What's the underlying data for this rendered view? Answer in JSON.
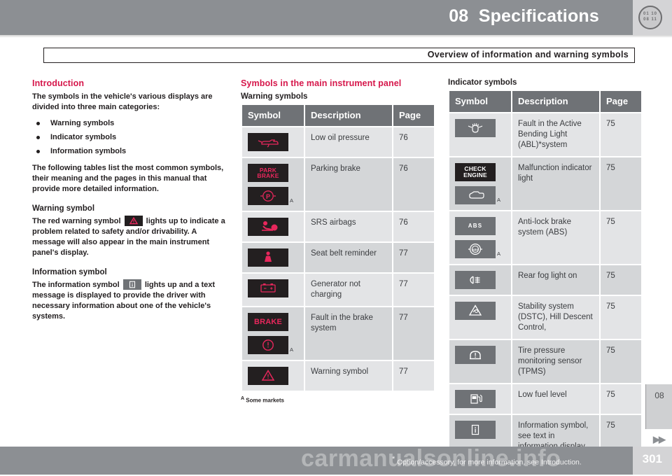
{
  "header": {
    "chapter_number": "08",
    "chapter_title": "Specifications",
    "badge_line1": "01 10",
    "badge_line2": "08 11"
  },
  "section_title": "Overview of information and warning symbols",
  "left_column": {
    "heading": "Introduction",
    "intro_paragraph": "The symbols in the vehicle's various displays are divided into three main categories:",
    "bullets": [
      "Warning symbols",
      "Indicator symbols",
      "Information symbols"
    ],
    "tables_paragraph": "The following tables list the most common symbols, their meaning and the pages in this manual that provide more detailed information.",
    "warning_heading": "Warning symbol",
    "warning_text_before": "The red warning symbol",
    "warning_text_after": "lights up to indicate a problem related to safety and/or drivability. A message will also appear in the main instrument panel's display.",
    "info_heading": "Information symbol",
    "info_text_before": "The information symbol",
    "info_text_after": "lights up and a text message is displayed to provide the driver with necessary information about one of the vehicle's systems."
  },
  "middle_column": {
    "heading": "Symbols in the main instrument panel",
    "subheading": "Warning symbols",
    "columns": [
      "Symbol",
      "Description",
      "Page"
    ],
    "rows": [
      {
        "icons": [
          {
            "kind": "oil-can",
            "style": "dark"
          }
        ],
        "description": "Low oil pressure",
        "page": "76"
      },
      {
        "icons": [
          {
            "kind": "park-brake-text",
            "style": "dark",
            "text1": "PARK",
            "text2": "BRAKE"
          },
          {
            "kind": "p-circle",
            "style": "dark",
            "note": "A"
          }
        ],
        "description": "Parking brake",
        "page": "76"
      },
      {
        "icons": [
          {
            "kind": "srs-airbag",
            "style": "dark"
          }
        ],
        "description": "SRS airbags",
        "page": "76"
      },
      {
        "icons": [
          {
            "kind": "seat-belt",
            "style": "dark"
          }
        ],
        "description": "Seat belt reminder",
        "page": "77"
      },
      {
        "icons": [
          {
            "kind": "battery",
            "style": "dark"
          }
        ],
        "description": "Generator not charging",
        "page": "77"
      },
      {
        "icons": [
          {
            "kind": "brake-text",
            "style": "dark",
            "text1": "BRAKE"
          },
          {
            "kind": "exclam-circle",
            "style": "dark",
            "note": "A"
          }
        ],
        "description": "Fault in the brake system",
        "page": "77"
      },
      {
        "icons": [
          {
            "kind": "warning-triangle",
            "style": "dark"
          }
        ],
        "description": "Warning symbol",
        "page": "77"
      }
    ],
    "footnote_marker": "A",
    "footnote_text": "Some markets"
  },
  "right_column": {
    "heading": "Indicator symbols",
    "columns": [
      "Symbol",
      "Description",
      "Page"
    ],
    "rows": [
      {
        "icons": [
          {
            "kind": "bending-light",
            "style": "grey"
          }
        ],
        "description": "Fault in the Active Bending Light (ABL)*system",
        "page": "75"
      },
      {
        "icons": [
          {
            "kind": "check-engine-text",
            "style": "dark",
            "text1": "CHECK",
            "text2": "ENGINE"
          },
          {
            "kind": "engine-outline",
            "style": "grey",
            "note": "A"
          }
        ],
        "description": "Malfunction indicator light",
        "page": "75"
      },
      {
        "icons": [
          {
            "kind": "abs-text",
            "style": "grey",
            "text1": "ABS"
          },
          {
            "kind": "abs-circle",
            "style": "grey",
            "note": "A"
          }
        ],
        "description": "Anti-lock brake system (ABS)",
        "page": "75"
      },
      {
        "icons": [
          {
            "kind": "rear-fog",
            "style": "grey"
          }
        ],
        "description": "Rear fog light on",
        "page": "75"
      },
      {
        "icons": [
          {
            "kind": "dstc-triangle",
            "style": "grey"
          }
        ],
        "description": "Stability system (DSTC), Hill Descent Control,",
        "page": "75"
      },
      {
        "icons": [
          {
            "kind": "tpms",
            "style": "grey"
          }
        ],
        "description": "Tire pressure monitoring sensor (TPMS)",
        "page": "75"
      },
      {
        "icons": [
          {
            "kind": "fuel-pump",
            "style": "grey"
          }
        ],
        "description": "Low fuel level",
        "page": "75"
      },
      {
        "icons": [
          {
            "kind": "info-i",
            "style": "grey"
          }
        ],
        "description": "Information symbol, see text in information display",
        "page": "75"
      }
    ]
  },
  "side_tab": {
    "number": "08",
    "next_arrows": "▶▶"
  },
  "footer": {
    "option_note_marker": "*",
    "option_note": "Option/accessory, for more information, see Introduction.",
    "page_number": "301",
    "watermark": "carmanualsonline.info"
  },
  "colors": {
    "header_gray": "#8c8f93",
    "accent_red": "#d6174b",
    "symbol_red": "#e8275c",
    "table_header_gray": "#6f7276",
    "row_light": "#e3e4e6",
    "row_dark": "#d4d6d8"
  }
}
